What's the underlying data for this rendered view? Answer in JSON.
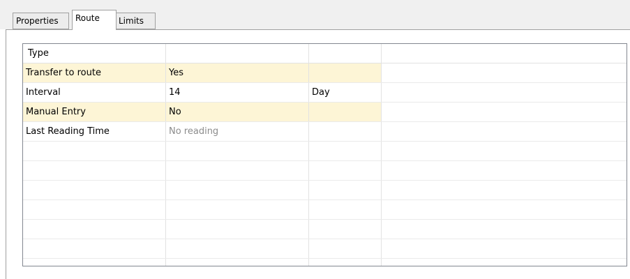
{
  "tabs": [
    {
      "label": "Properties",
      "active": false
    },
    {
      "label": "Route",
      "active": true
    },
    {
      "label": "Limits",
      "active": false
    }
  ],
  "grid": {
    "columns": [
      "Type",
      "",
      "",
      ""
    ],
    "rows": [
      {
        "name": "Transfer to route",
        "value": "Yes",
        "unit": "",
        "highlight": true
      },
      {
        "name": "Interval",
        "value": "14",
        "unit": "Day",
        "highlight": false
      },
      {
        "name": "Manual Entry",
        "value": "No",
        "unit": "",
        "highlight": true
      },
      {
        "name": "Last Reading Time",
        "value": "No reading",
        "unit": "",
        "highlight": false
      }
    ],
    "highlight_color": "#fdf5d6"
  }
}
